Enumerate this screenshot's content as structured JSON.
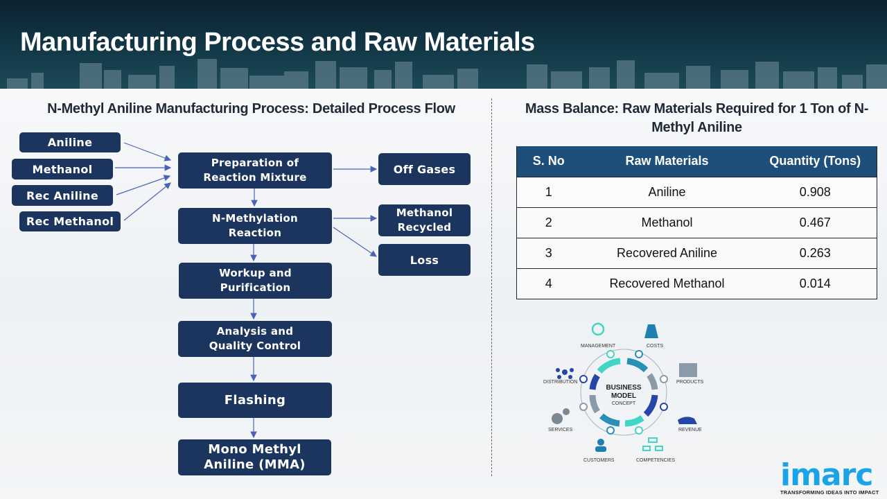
{
  "header": {
    "title": "Manufacturing Process and Raw Materials"
  },
  "process_flow": {
    "title": "N-Methyl Aniline Manufacturing Process: Detailed Process Flow",
    "inputs": [
      "Aniline",
      "Methanol",
      "Rec Aniline",
      "Rec Methanol"
    ],
    "steps": [
      "Preparation of\nReaction Mixture",
      "N-Methylation\nReaction",
      "Workup and\nPurification",
      "Analysis and\nQuality Control",
      "Flashing",
      "Mono Methyl\nAniline (MMA)"
    ],
    "outputs": [
      "Off Gases",
      "Methanol\nRecycled",
      "Loss"
    ]
  },
  "mass_balance": {
    "title": "Mass Balance: Raw Materials Required for 1 Ton of N-Methyl Aniline",
    "columns": [
      "S. No",
      "Raw Materials",
      "Quantity (Tons)"
    ],
    "rows": [
      [
        "1",
        "Aniline",
        "0.908"
      ],
      [
        "2",
        "Methanol",
        "0.467"
      ],
      [
        "3",
        "Recovered Aniline",
        "0.263"
      ],
      [
        "4",
        "Recovered Methanol",
        "0.014"
      ]
    ]
  },
  "business_model": {
    "center": [
      "BUSINESS",
      "MODEL",
      "CONCEPT"
    ],
    "labels": [
      "MANAGEMENT",
      "COSTS",
      "DISTRIBUTION",
      "PRODUCTS",
      "SERVICES",
      "REVENUE",
      "CUSTOMERS",
      "COMPETENCIES"
    ]
  },
  "logo": {
    "name": "imarc",
    "tagline": "TRANSFORMING IDEAS INTO IMPACT"
  },
  "colors": {
    "box": "#1c355e",
    "table_header": "#1d4f7a",
    "arrow": "#4a63b8",
    "brand": "#1aa3e8"
  }
}
